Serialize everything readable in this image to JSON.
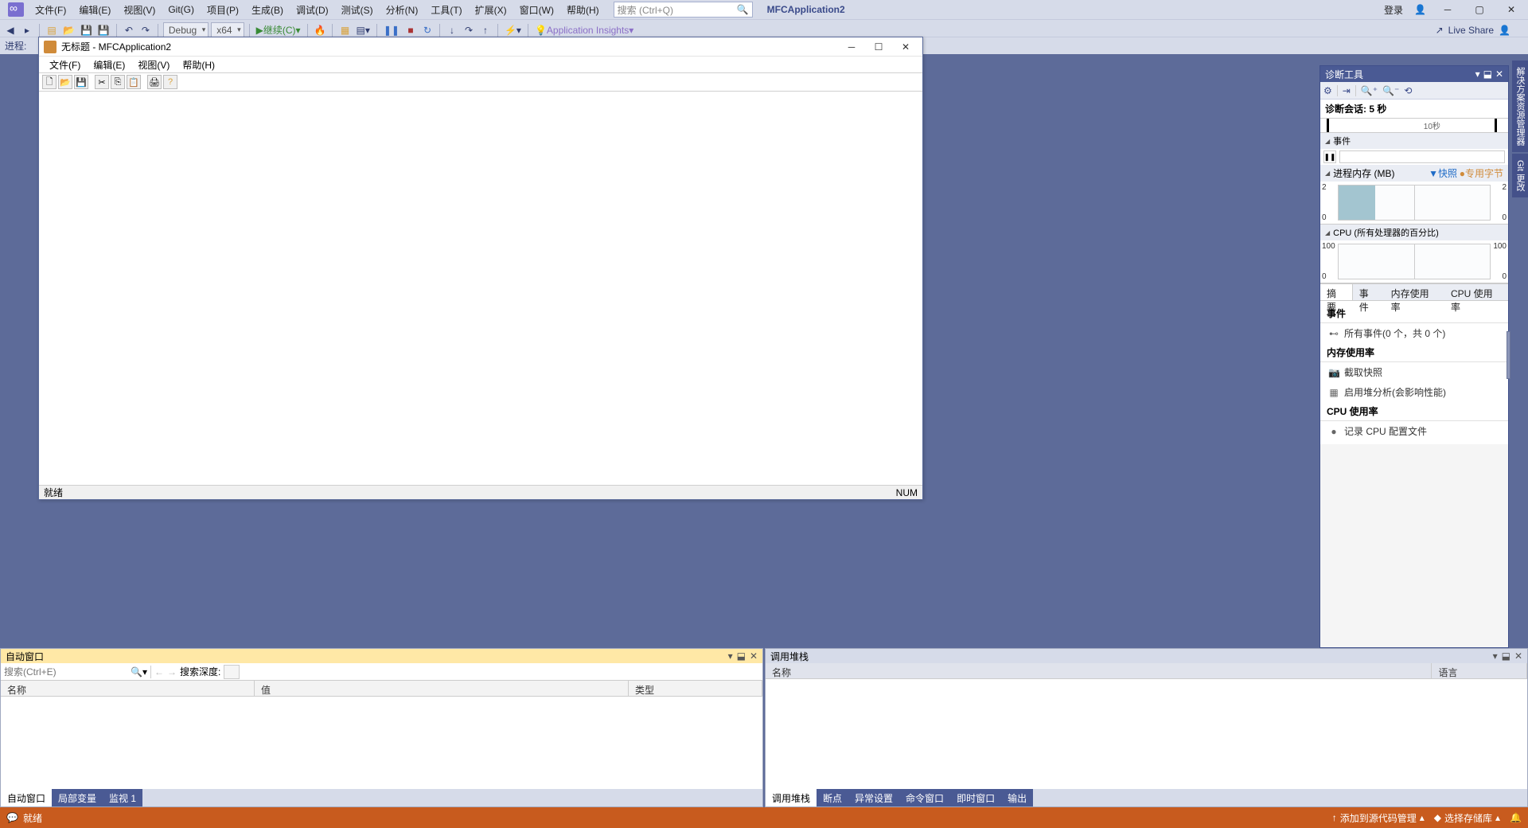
{
  "menu": {
    "file": "文件(F)",
    "edit": "编辑(E)",
    "view": "视图(V)",
    "git": "Git(G)",
    "project": "项目(P)",
    "build": "生成(B)",
    "debug": "调试(D)",
    "test": "测试(S)",
    "analyze": "分析(N)",
    "tools": "工具(T)",
    "extensions": "扩展(X)",
    "window": "窗口(W)",
    "help": "帮助(H)"
  },
  "search": {
    "placeholder": "搜索 (Ctrl+Q)"
  },
  "app_title": "MFCApplication2",
  "login": "登录",
  "toolbar": {
    "config": "Debug",
    "platform": "x64",
    "continue": "继续(C)",
    "insights": "Application Insights"
  },
  "live_share": "Live Share",
  "process_label": "进程:",
  "mfc": {
    "title": "无标题 - MFCApplication2",
    "menu": {
      "file": "文件(F)",
      "edit": "编辑(E)",
      "view": "视图(V)",
      "help": "帮助(H)"
    },
    "status_ready": "就绪",
    "status_num": "NUM"
  },
  "diag": {
    "title": "诊断工具",
    "session": "诊断会话: 5 秒",
    "timeline_10s": "10秒",
    "events": "事件",
    "memory": "进程内存 (MB)",
    "mem_legend_snap": "▼快照",
    "mem_legend_priv": "●专用字节",
    "cpu": "CPU (所有处理器的百分比)",
    "mem_max": "2",
    "mem_min": "0",
    "cpu_max": "100",
    "cpu_min": "0",
    "tabs": {
      "summary": "摘要",
      "events": "事件",
      "memory": "内存使用率",
      "cpu": "CPU 使用率"
    },
    "body_events": "事件",
    "body_allevents": "所有事件(0 个，共 0 个)",
    "body_memory": "内存使用率",
    "body_snapshot": "截取快照",
    "body_heap": "启用堆分析(会影响性能)",
    "body_cpu": "CPU 使用率",
    "body_record": "记录 CPU 配置文件"
  },
  "vtabs": {
    "solution": "解决方案资源管理器",
    "git": "Git 更改"
  },
  "auto": {
    "title": "自动窗口",
    "search_placeholder": "搜索(Ctrl+E)",
    "depth_label": "搜索深度:",
    "col_name": "名称",
    "col_value": "值",
    "col_type": "类型",
    "tabs": {
      "auto": "自动窗口",
      "locals": "局部变量",
      "watch": "监视 1"
    }
  },
  "callstack": {
    "title": "调用堆栈",
    "col_name": "名称",
    "col_lang": "语言",
    "tabs": {
      "callstack": "调用堆栈",
      "breakpoints": "断点",
      "exception": "异常设置",
      "command": "命令窗口",
      "immediate": "即时窗口",
      "output": "输出"
    }
  },
  "status": {
    "ready": "就绪",
    "source_control": "添加到源代码管理",
    "repo": "选择存储库"
  }
}
